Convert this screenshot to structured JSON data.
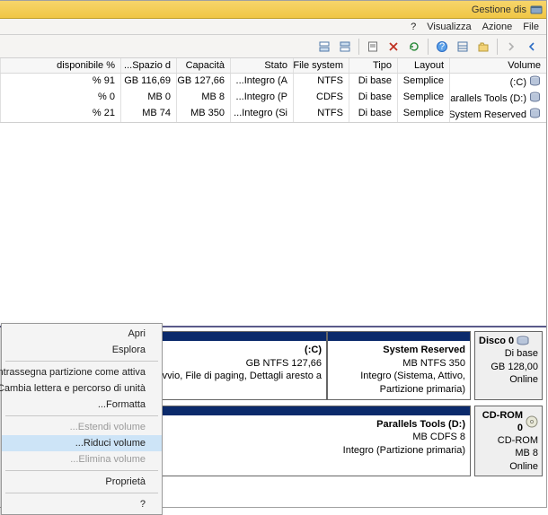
{
  "window": {
    "title": "Gestione dis"
  },
  "menus": {
    "file": "File",
    "action": "Azione",
    "view": "Visualizza",
    "help": "?"
  },
  "toolbar": {
    "back": "back-icon",
    "fwd": "forward-icon",
    "up": "up-icon",
    "refresh": "refresh-icon",
    "props": "properties-icon",
    "delete": "delete-icon",
    "help": "help-icon",
    "view1": "list-view-icon",
    "view2": "detail-view-icon"
  },
  "columns": {
    "volume": "Volume",
    "layout": "Layout",
    "tipo": "Tipo",
    "fs": "File system",
    "stato": "Stato",
    "capacita": "Capacità",
    "spazio": "Spazio d...",
    "pct": "% disponibile"
  },
  "rows": [
    {
      "volume": "(C:)",
      "layout": "Semplice",
      "tipo": "Di base",
      "fs": "NTFS",
      "stato": "Integro (A...",
      "cap": "127,66 GB",
      "sp": "116,69 GB",
      "pct": "91 %"
    },
    {
      "volume": "Parallels Tools (D:)",
      "layout": "Semplice",
      "tipo": "Di base",
      "fs": "CDFS",
      "stato": "Integro (P...",
      "cap": "8 MB",
      "sp": "0 MB",
      "pct": "0 %"
    },
    {
      "volume": "System Reserved",
      "layout": "Semplice",
      "tipo": "Di base",
      "fs": "NTFS",
      "stato": "Integro (Si...",
      "cap": "350 MB",
      "sp": "74 MB",
      "pct": "21 %"
    }
  ],
  "disks": [
    {
      "name": "Disco 0",
      "type": "Di base",
      "size": "128,00 GB",
      "status": "Online",
      "partitions": [
        {
          "title": "System Reserved",
          "sub1": "350 MB NTFS",
          "sub2": "Integro (Sistema, Attivo, Partizione primaria)",
          "flex": "0 0 160px"
        },
        {
          "title": "(C:)",
          "sub1": "127,66 GB NTFS",
          "sub2": "Integro (Avvio, File di paging, Dettagli aresto a",
          "flex": "1"
        }
      ]
    },
    {
      "name": "CD-ROM 0",
      "type": "CD-ROM",
      "size": "8 MB",
      "status": "Online",
      "icon": "cd",
      "partitions": [
        {
          "title": "Parallels Tools  (D:)",
          "sub1": "8 MB CDFS",
          "sub2": "Integro (Partizione primaria)",
          "flex": "1"
        }
      ]
    }
  ],
  "context": {
    "open": "Apri",
    "explore": "Esplora",
    "mark": "Contrassegna partizione come attiva",
    "change": "Cambia lettera e percorso di unità...",
    "format": "Formatta...",
    "extend": "Estendi volume...",
    "shrink": "Riduci volume...",
    "delete": "Elimina volume...",
    "props": "Proprietà",
    "help": "?"
  }
}
